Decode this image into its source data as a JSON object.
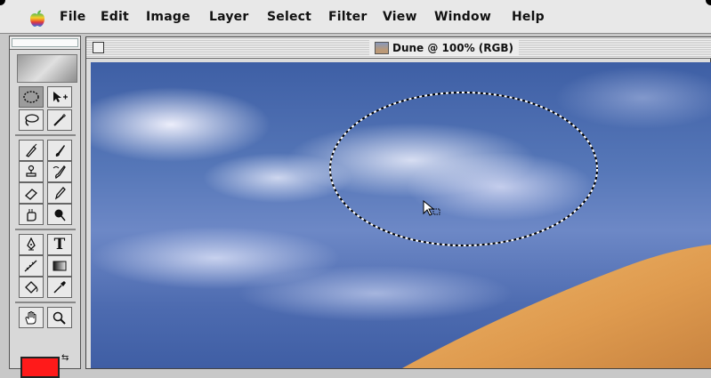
{
  "menubar": {
    "items": [
      "File",
      "Edit",
      "Image",
      "Layer",
      "Select",
      "Filter",
      "View",
      "Window",
      "Help"
    ]
  },
  "document": {
    "title": "Dune @ 100% (RGB)"
  },
  "toolbox": {
    "foreground_color": "#ff1a1a"
  },
  "colors": {
    "sky_dark": "#3e5fa5",
    "sand": "#e3a256",
    "selection": "#ffffff"
  },
  "icons": [
    "apple-icon",
    "marquee-tool-icon",
    "move-tool-icon",
    "lasso-tool-icon",
    "magic-wand-tool-icon",
    "airbrush-tool-icon",
    "paintbrush-tool-icon",
    "rubber-stamp-tool-icon",
    "history-brush-tool-icon",
    "eraser-tool-icon",
    "pencil-tool-icon",
    "smudge-tool-icon",
    "dodge-tool-icon",
    "pen-tool-icon",
    "type-tool-icon",
    "measure-tool-icon",
    "gradient-tool-icon",
    "paint-bucket-tool-icon",
    "eyedropper-tool-icon",
    "hand-tool-icon",
    "zoom-tool-icon",
    "pointer-cursor-icon"
  ]
}
